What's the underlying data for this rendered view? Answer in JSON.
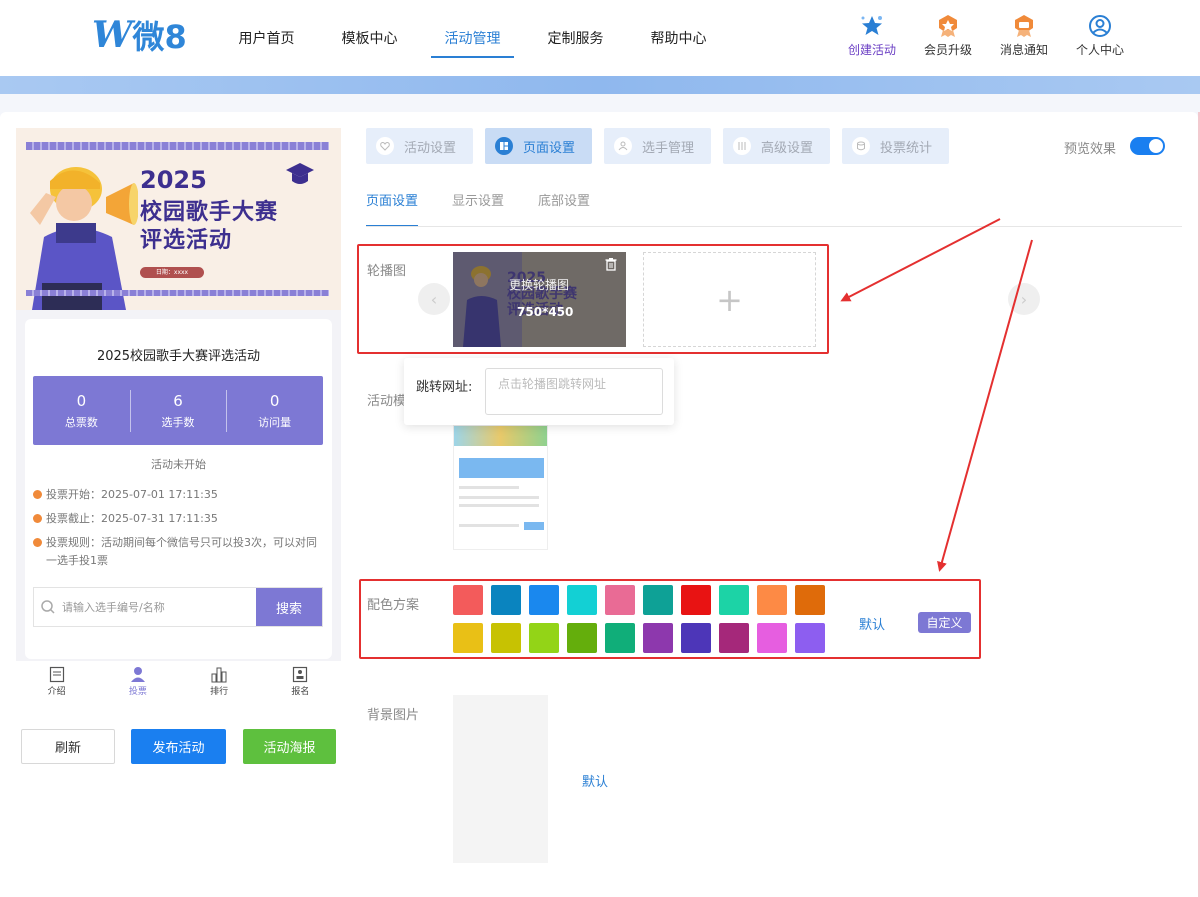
{
  "header": {
    "logo_letter": "W",
    "logo_text": "微8",
    "nav": [
      {
        "label": "用户首页"
      },
      {
        "label": "模板中心"
      },
      {
        "label": "活动管理"
      },
      {
        "label": "定制服务"
      },
      {
        "label": "帮助中心"
      }
    ],
    "active_nav": "活动管理",
    "actions": [
      {
        "label": "创建活动",
        "icon": "star-icon"
      },
      {
        "label": "会员升级",
        "icon": "member-badge-icon"
      },
      {
        "label": "消息通知",
        "icon": "message-badge-icon"
      },
      {
        "label": "个人中心",
        "icon": "user-circle-icon"
      }
    ]
  },
  "preview": {
    "banner": {
      "year": "2025",
      "title_line1": "校园歌手大赛",
      "title_line2": "评选活动",
      "date_tag": "日期：xxxx"
    },
    "activity_title": "2025校园歌手大赛评选活动",
    "stats": [
      {
        "value": "0",
        "label": "总票数"
      },
      {
        "value": "6",
        "label": "选手数"
      },
      {
        "value": "0",
        "label": "访问量"
      }
    ],
    "status": "活动未开始",
    "vote_start": "投票开始：2025-07-01 17:11:35",
    "vote_end": "投票截止：2025-07-31 17:11:35",
    "vote_rule": "投票规则：活动期间每个微信号只可以投3次，可以对同一选手投1票",
    "search_placeholder": "请输入选手编号/名称",
    "search_button": "搜索",
    "tabbar": [
      {
        "label": "介绍"
      },
      {
        "label": "投票"
      },
      {
        "label": "排行"
      },
      {
        "label": "报名"
      }
    ]
  },
  "left_buttons": {
    "refresh": "刷新",
    "publish": "发布活动",
    "poster": "活动海报"
  },
  "settings": {
    "tabs": [
      {
        "label": "活动设置"
      },
      {
        "label": "页面设置"
      },
      {
        "label": "选手管理"
      },
      {
        "label": "高级设置"
      },
      {
        "label": "投票统计"
      }
    ],
    "active_tab": "页面设置",
    "preview_label": "预览效果",
    "preview_on": true,
    "subtabs": [
      {
        "label": "页面设置"
      },
      {
        "label": "显示设置"
      },
      {
        "label": "底部设置"
      }
    ],
    "carousel_label": "轮播图",
    "carousel_change_text": "更换轮播图",
    "carousel_size": "750*450",
    "add_symbol": "+",
    "jump_label": "跳转网址:",
    "jump_placeholder": "点击轮播图跳转网址",
    "template_label": "活动模",
    "color_label": "配色方案",
    "color_swatches": [
      "#f35b5b",
      "#0a84bf",
      "#1a88ee",
      "#13d0d4",
      "#e96b95",
      "#0ea196",
      "#e81313",
      "#1cd3a6",
      "#fd8a45",
      "#df6b0a",
      "#e9c016",
      "#c7c202",
      "#93d417",
      "#64ae0c",
      "#10ae79",
      "#8d38ad",
      "#4d36b8",
      "#a5287a",
      "#e65ee0",
      "#8d5ef0"
    ],
    "color_default": "默认",
    "color_custom": "自定义",
    "bg_label": "背景图片",
    "bg_default": "默认"
  },
  "colors": {
    "primary_blue": "#1a7ff0",
    "accent_purple": "#7d78d4",
    "annotation_red": "#e43030"
  }
}
